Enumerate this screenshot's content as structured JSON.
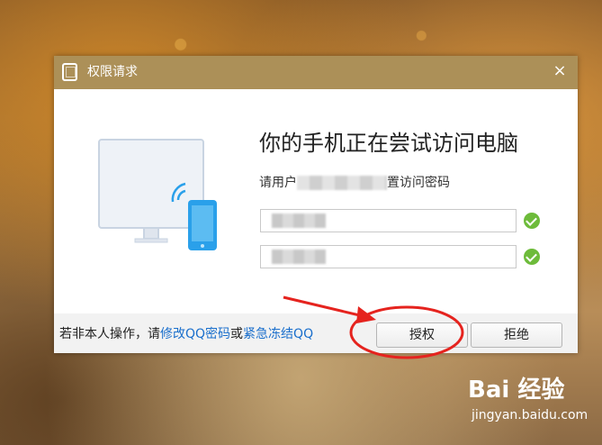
{
  "dialog": {
    "title": "权限请求",
    "close_glyph": "×",
    "heading": "你的手机正在尝试访问电脑",
    "desc_prefix": "请用户",
    "desc_suffix": "置访问密码",
    "field1_value": "",
    "field2_value": "",
    "footer": {
      "text_prefix": "若非本人操作，请",
      "link_change_password": "修改QQ密码",
      "text_or": "或",
      "link_freeze": "紧急冻结QQ"
    },
    "buttons": {
      "authorize": "授权",
      "deny": "拒绝"
    }
  },
  "colors": {
    "titlebar": "#ac9058",
    "link": "#1a6fcc",
    "check": "#6dbb3a",
    "annotation": "#e5231e",
    "phone": "#2aa0ea"
  },
  "icons": {
    "title": "tablet-icon",
    "close": "close-icon",
    "check": "check-circle-icon"
  },
  "watermark": {
    "logo": "Bai  经验",
    "sub": "jingyan.baidu.com"
  }
}
